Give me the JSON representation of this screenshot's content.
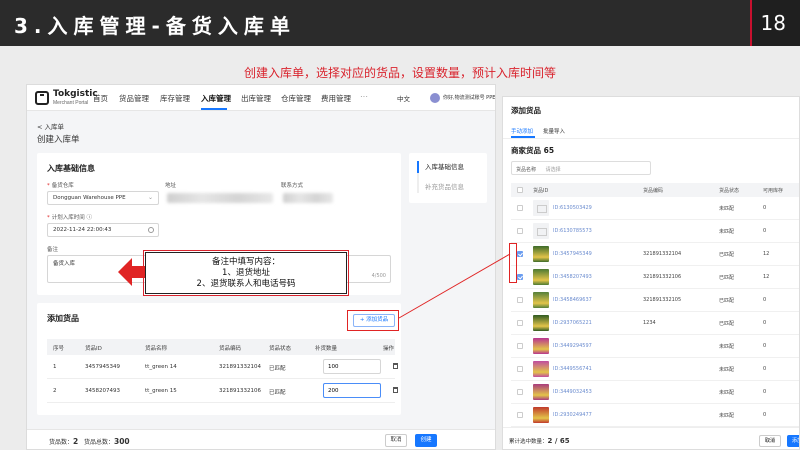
{
  "slide": {
    "title": "3.入库管理-备货入库单",
    "page_number": "18",
    "caption": "创建入库单，选择对应的货品，设置数量，预计入库时间等"
  },
  "app": {
    "logo": {
      "name": "Tokgistic",
      "sub": "Merchant Portal"
    },
    "nav": [
      "首页",
      "货品管理",
      "库存管理",
      "入库管理",
      "出库管理",
      "仓库管理",
      "费用管理"
    ],
    "nav_more": "···",
    "lang": "中文",
    "user": "你好,物流测试账号 PPE",
    "back": "< 入库单",
    "page_title": "创建入库单",
    "basic": {
      "title": "入库基础信息",
      "warehouse_label": "备货仓库",
      "warehouse_value": "Dongguan Warehouse PPE",
      "address_label": "地址",
      "contact_label": "联系方式",
      "time_label": "计划入库时间",
      "time_value": "2022-11-24 22:00:43",
      "remark_label": "备注",
      "remark_value": "备货入库",
      "remark_counter": "4/500"
    },
    "steps": [
      "入库基础信息",
      "补充货品信息"
    ],
    "goods": {
      "title": "添加货品",
      "add_button": "+ 添加货品",
      "columns": [
        "序号",
        "货品ID",
        "货品名称",
        "货品编码",
        "货品状态",
        "补货数量",
        "操作"
      ],
      "rows": [
        {
          "no": "1",
          "id": "3457945349",
          "name": "tt_green 14",
          "code": "321891332104",
          "status": "已匹配",
          "qty": "100"
        },
        {
          "no": "2",
          "id": "3458207493",
          "name": "tt_green 15",
          "code": "321891332106",
          "status": "已匹配",
          "qty": "200"
        }
      ]
    },
    "footer": {
      "kinds_label": "货品数：",
      "kinds_value": "2",
      "total_label": "货品总数：",
      "total_value": "300",
      "cancel": "取消",
      "create": "创建"
    }
  },
  "callout": {
    "line1": "备注中填写内容：",
    "line2": "1、退货地址",
    "line3": "2、退货联系人和电话号码"
  },
  "modal": {
    "title": "添加货品",
    "tabs": [
      "手动添加",
      "批量导入"
    ],
    "subtitle": "商家货品 65",
    "search_label": "货品名称",
    "search_placeholder": "请选择",
    "columns": [
      "货品ID",
      "货品编码",
      "货品状态",
      "可用库存"
    ],
    "rows": [
      {
        "checked": false,
        "thumb": "placeholder",
        "id": "ID:6130503429",
        "code": "",
        "status": "未匹配",
        "stock": "0"
      },
      {
        "checked": false,
        "thumb": "placeholder",
        "id": "ID:6130785573",
        "code": "",
        "status": "未匹配",
        "stock": "0"
      },
      {
        "checked": true,
        "thumb": "#3d6b2a",
        "id": "ID:3457945349",
        "code": "321891332104",
        "status": "已匹配",
        "stock": "12"
      },
      {
        "checked": true,
        "thumb": "#4c7a33",
        "id": "ID:3458207493",
        "code": "321891332106",
        "status": "已匹配",
        "stock": "12"
      },
      {
        "checked": false,
        "thumb": "#55803a",
        "id": "ID:3458469637",
        "code": "321891332105",
        "status": "已匹配",
        "stock": "0"
      },
      {
        "checked": false,
        "thumb": "#2f5a22",
        "id": "ID:2937065221",
        "code": "1234",
        "status": "已匹配",
        "stock": "0"
      },
      {
        "checked": false,
        "thumb": "#b8348f",
        "id": "ID:3449294597",
        "code": "",
        "status": "未匹配",
        "stock": "0"
      },
      {
        "checked": false,
        "thumb": "#c04da0",
        "id": "ID:3449556741",
        "code": "",
        "status": "未匹配",
        "stock": "0"
      },
      {
        "checked": false,
        "thumb": "#a93c7e",
        "id": "ID:3449032453",
        "code": "",
        "status": "未匹配",
        "stock": "0"
      },
      {
        "checked": false,
        "thumb": "#c0392b",
        "id": "ID:2930249477",
        "code": "",
        "status": "未匹配",
        "stock": "0"
      }
    ],
    "footer_label": "累计选中数量：",
    "footer_value": "2 / 65",
    "cancel": "取消",
    "ok": "添加"
  }
}
